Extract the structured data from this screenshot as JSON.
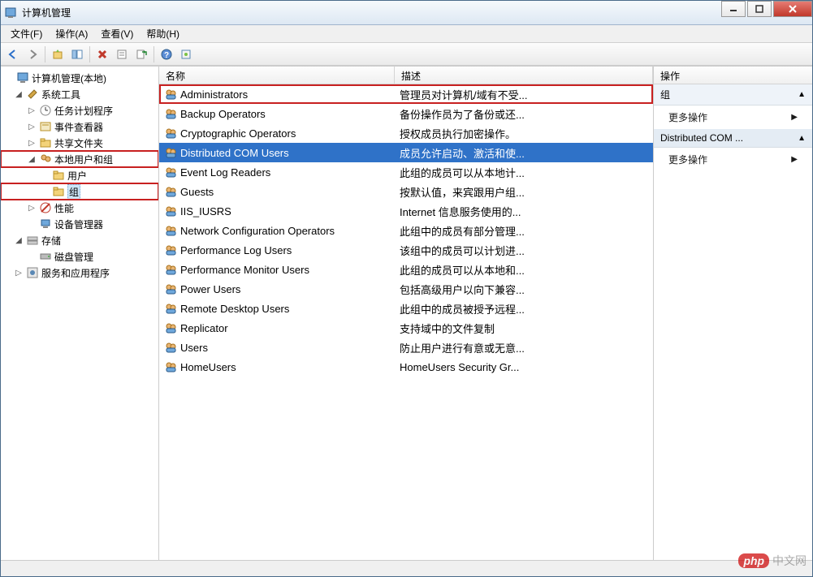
{
  "window": {
    "title": "计算机管理"
  },
  "menu": {
    "file": "文件(F)",
    "action": "操作(A)",
    "view": "查看(V)",
    "help": "帮助(H)"
  },
  "tree": {
    "root": "计算机管理(本地)",
    "systools": "系统工具",
    "taskscheduler": "任务计划程序",
    "eventviewer": "事件查看器",
    "sharedfolders": "共享文件夹",
    "localusers": "本地用户和组",
    "users": "用户",
    "groups": "组",
    "performance": "性能",
    "devicemgr": "设备管理器",
    "storage": "存储",
    "diskmgmt": "磁盘管理",
    "services": "服务和应用程序"
  },
  "list": {
    "col_name": "名称",
    "col_desc": "描述",
    "rows": [
      {
        "name": "Administrators",
        "desc": "管理员对计算机/域有不受..."
      },
      {
        "name": "Backup Operators",
        "desc": "备份操作员为了备份或还..."
      },
      {
        "name": "Cryptographic Operators",
        "desc": "授权成员执行加密操作。"
      },
      {
        "name": "Distributed COM Users",
        "desc": "成员允许启动、激活和使..."
      },
      {
        "name": "Event Log Readers",
        "desc": "此组的成员可以从本地计..."
      },
      {
        "name": "Guests",
        "desc": "按默认值，来宾跟用户组..."
      },
      {
        "name": "IIS_IUSRS",
        "desc": "Internet 信息服务使用的..."
      },
      {
        "name": "Network Configuration Operators",
        "desc": "此组中的成员有部分管理..."
      },
      {
        "name": "Performance Log Users",
        "desc": "该组中的成员可以计划进..."
      },
      {
        "name": "Performance Monitor Users",
        "desc": "此组的成员可以从本地和..."
      },
      {
        "name": "Power Users",
        "desc": "包括高级用户以向下兼容..."
      },
      {
        "name": "Remote Desktop Users",
        "desc": "此组中的成员被授予远程..."
      },
      {
        "name": "Replicator",
        "desc": "支持域中的文件复制"
      },
      {
        "name": "Users",
        "desc": "防止用户进行有意或无意..."
      },
      {
        "name": "HomeUsers",
        "desc": "HomeUsers Security Gr..."
      }
    ],
    "selected_index": 3,
    "boxed_index": 0
  },
  "actions": {
    "header": "操作",
    "section1": "组",
    "more1": "更多操作",
    "section2": "Distributed COM ...",
    "more2": "更多操作"
  },
  "watermark": {
    "brand": "php",
    "text": "中文网"
  }
}
